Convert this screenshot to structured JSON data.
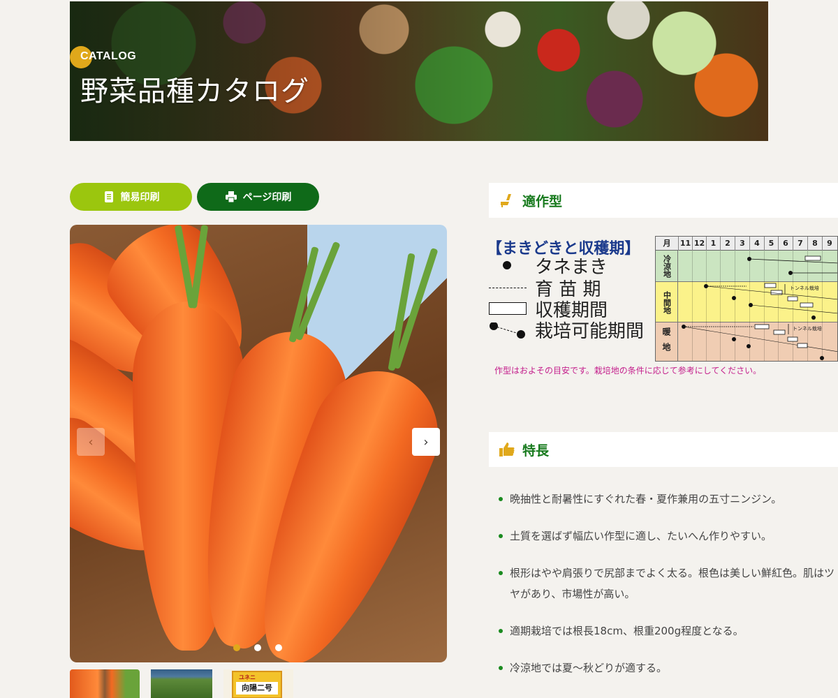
{
  "hero": {
    "subtitle": "CATALOG",
    "title": "野菜品種カタログ"
  },
  "buttons": {
    "simple_print": "簡易印刷",
    "page_print": "ページ印刷"
  },
  "gallery": {
    "prev_icon": "‹",
    "next_icon": "›",
    "slide_count": 3,
    "active_slide": 1,
    "thumb3_top": "ユネニ",
    "thumb3_label": "向陽二号"
  },
  "cropping_type": {
    "title": "適作型",
    "legend_title": "【まきどきと収穫期】",
    "legend": {
      "sowing": "タネまき",
      "seedling": "育 苗 期",
      "harvest": "収穫期間",
      "cultivation": "栽培可能期間"
    },
    "calendar": {
      "month_header": "月",
      "months": [
        "11",
        "12",
        "1",
        "2",
        "3",
        "4",
        "5",
        "6",
        "7",
        "8",
        "9"
      ],
      "zones": {
        "cold": "冷涼地",
        "mid": "中間地",
        "warm": "暖地"
      },
      "tunnel_mid": "トンネル栽培",
      "tunnel_warm": "トンネル栽培"
    },
    "note": "作型はおよその目安です。栽培地の条件に応じて参考にしてください。"
  },
  "features": {
    "title": "特長",
    "items": [
      "晩抽性と耐暑性にすぐれた春・夏作兼用の五寸ニンジン。",
      "土質を選ばず幅広い作型に適し、たいへん作りやすい。",
      "根形はやや肩張りで尻部までよく太る。根色は美しい鮮紅色。肌はツヤがあり、市場性が高い。",
      "適期栽培では根長18cm、根重200g程度となる。",
      "冷涼地では夏〜秋どりが適する。"
    ]
  },
  "colors": {
    "accent_green": "#177a1d",
    "light_green": "#9bc60e",
    "dark_green": "#0f6a19",
    "gold": "#e0a81b",
    "legend_blue": "#1b3a8c",
    "note_magenta": "#c41f8c"
  }
}
